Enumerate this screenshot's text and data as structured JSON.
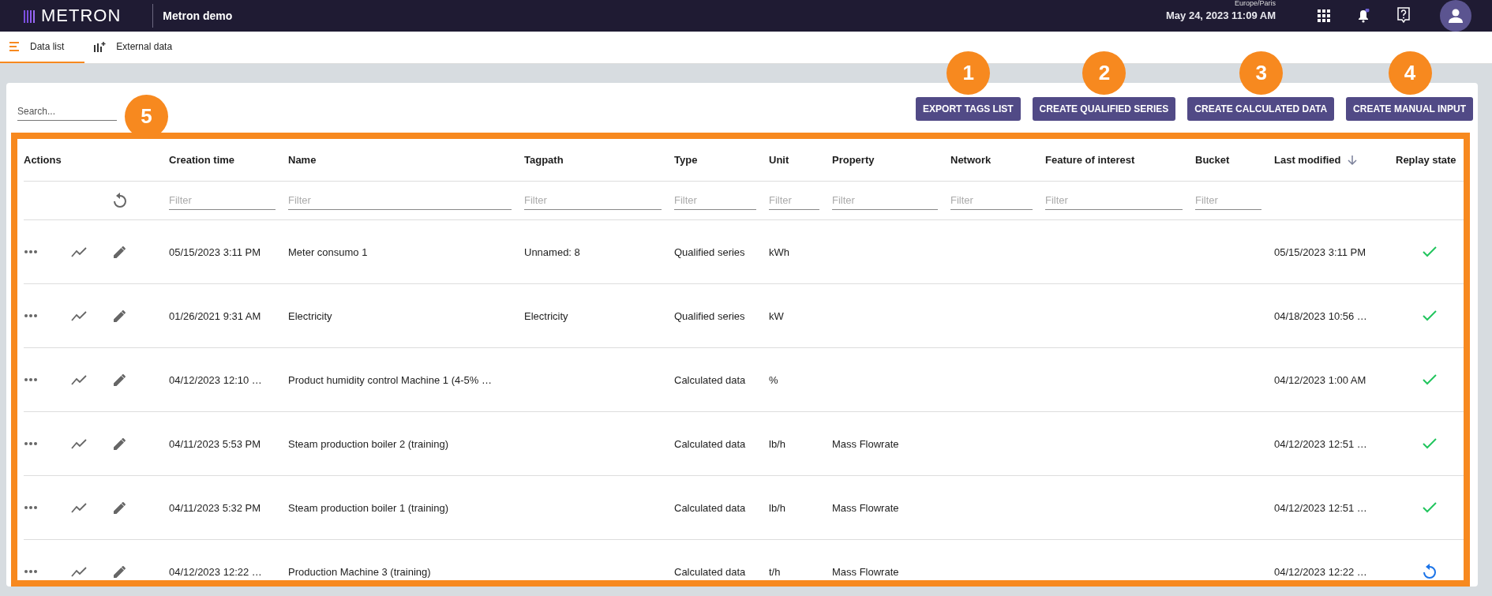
{
  "header": {
    "logo": "METRON",
    "app_name": "Metron demo",
    "timezone": "Europe/Paris",
    "datetime": "May 24, 2023 11:09 AM"
  },
  "tabs": [
    {
      "label": "Data list",
      "selected": true
    },
    {
      "label": "External data",
      "selected": false
    }
  ],
  "search": {
    "placeholder": "Search...",
    "callout": "5"
  },
  "buttons": [
    {
      "label": "EXPORT TAGS LIST",
      "callout": "1"
    },
    {
      "label": "CREATE QUALIFIED SERIES",
      "callout": "2"
    },
    {
      "label": "CREATE CALCULATED DATA",
      "callout": "3"
    },
    {
      "label": "CREATE MANUAL INPUT",
      "callout": "4"
    }
  ],
  "table": {
    "columns": [
      {
        "label": "Actions"
      },
      {
        "label": "Creation time",
        "placeholder": "Filter"
      },
      {
        "label": "Name",
        "placeholder": "Filter"
      },
      {
        "label": "Tagpath",
        "placeholder": "Filter"
      },
      {
        "label": "Type",
        "placeholder": "Filter"
      },
      {
        "label": "Unit",
        "placeholder": "Filter"
      },
      {
        "label": "Property",
        "placeholder": "Filter"
      },
      {
        "label": "Network",
        "placeholder": "Filter"
      },
      {
        "label": "Feature of interest",
        "placeholder": "Filter"
      },
      {
        "label": "Bucket",
        "placeholder": "Filter"
      },
      {
        "label": "Last modified",
        "sorted": true
      },
      {
        "label": "Replay state"
      }
    ],
    "rows": [
      {
        "cells": [
          "",
          "05/15/2023 3:11 PM",
          "Meter consumo 1",
          "Unnamed: 8",
          "Qualified series",
          "kWh",
          "",
          "",
          "",
          "",
          "05/15/2023 3:11 PM"
        ],
        "replayed": true
      },
      {
        "cells": [
          "",
          "01/26/2021 9:31 AM",
          "Electricity",
          "Electricity",
          "Qualified series",
          "kW",
          "",
          "",
          "",
          "",
          "04/18/2023 10:56 …"
        ],
        "replayed": true
      },
      {
        "cells": [
          "",
          "04/12/2023 12:10 …",
          "Product humidity control Machine 1 (4-5% …",
          "",
          "Calculated data",
          "%",
          "",
          "",
          "",
          "",
          "04/12/2023 1:00 AM"
        ],
        "replayed": true
      },
      {
        "cells": [
          "",
          "04/11/2023 5:53 PM",
          "Steam production boiler 2 (training)",
          "",
          "Calculated data",
          "lb/h",
          "Mass Flowrate",
          "",
          "",
          "",
          "04/12/2023 12:51 …"
        ],
        "replayed": true
      },
      {
        "cells": [
          "",
          "04/11/2023 5:32 PM",
          "Steam production boiler 1 (training)",
          "",
          "Calculated data",
          "lb/h",
          "Mass Flowrate",
          "",
          "",
          "",
          "04/12/2023 12:51 …"
        ],
        "replayed": true
      },
      {
        "cells": [
          "",
          "04/12/2023 12:22 …",
          "Production Machine 3 (training)",
          "",
          "Calculated data",
          "t/h",
          "Mass Flowrate",
          "",
          "",
          "",
          "04/12/2023 12:22 …"
        ],
        "replayed": false
      }
    ]
  }
}
